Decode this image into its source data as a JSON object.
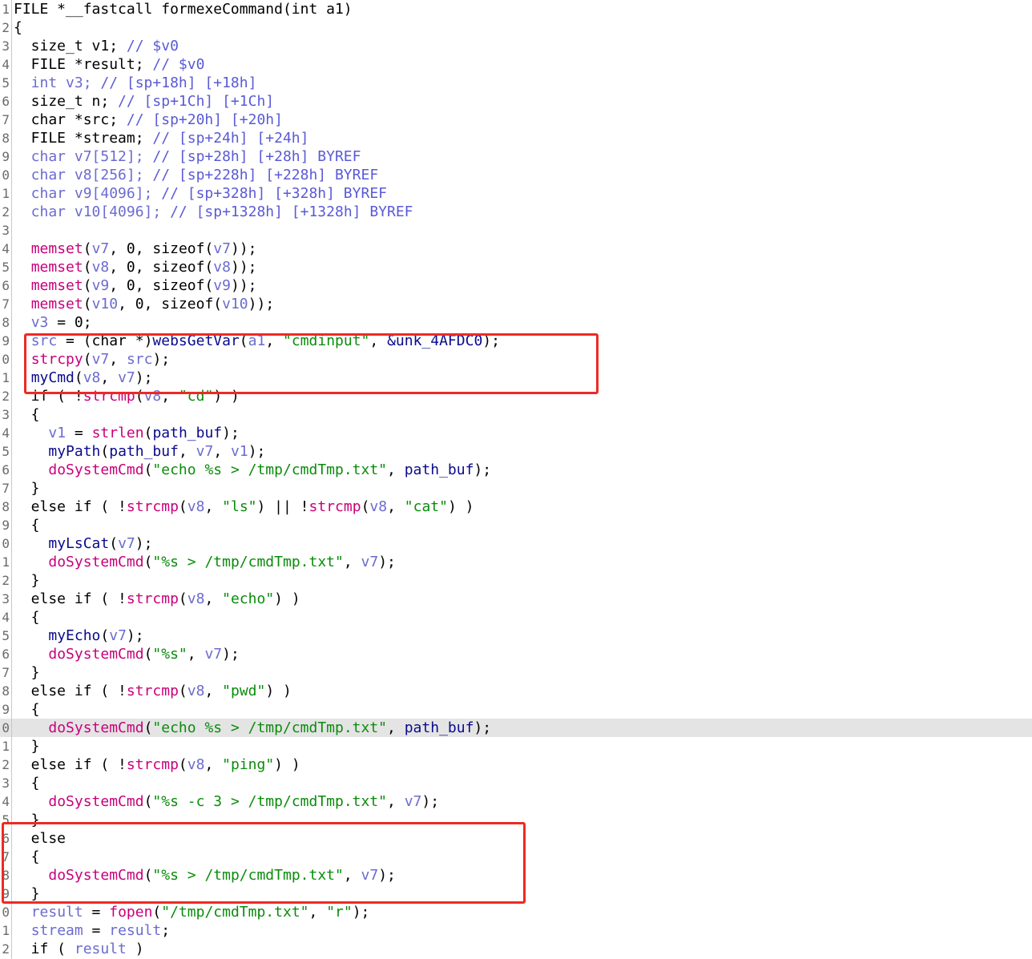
{
  "editor": {
    "view": "pseudocode",
    "highlight_color": "#e4e4e4",
    "annotation_color": "#ee2a24",
    "highlighted_line": 40,
    "colors": {
      "keyword": "#000000",
      "variable": "#6b6bd0",
      "comment": "#5a5ad6",
      "library_function": "#c8007a",
      "user_function": "#0a0a8c",
      "string": "#0a8c0a",
      "global": "#0a0a8c"
    },
    "lines": [
      {
        "n": "1",
        "t": [
          [
            "k",
            "FILE *__fastcall formexeCommand(int a1)"
          ]
        ]
      },
      {
        "n": "2",
        "t": [
          [
            "k",
            "{"
          ]
        ]
      },
      {
        "n": "3",
        "t": [
          [
            "k",
            "  size_t v1; "
          ],
          [
            "c",
            "// $v0"
          ]
        ]
      },
      {
        "n": "4",
        "t": [
          [
            "k",
            "  FILE *result; "
          ],
          [
            "c",
            "// $v0"
          ]
        ]
      },
      {
        "n": "5",
        "t": [
          [
            "v",
            "  int v3; "
          ],
          [
            "c",
            "// [sp+18h] [+18h]"
          ]
        ]
      },
      {
        "n": "6",
        "t": [
          [
            "k",
            "  size_t n; "
          ],
          [
            "c",
            "// [sp+1Ch] [+1Ch]"
          ]
        ]
      },
      {
        "n": "7",
        "t": [
          [
            "k",
            "  char *src; "
          ],
          [
            "c",
            "// [sp+20h] [+20h]"
          ]
        ]
      },
      {
        "n": "8",
        "t": [
          [
            "k",
            "  FILE *stream; "
          ],
          [
            "c",
            "// [sp+24h] [+24h]"
          ]
        ]
      },
      {
        "n": "9",
        "t": [
          [
            "v",
            "  char v7[512]; "
          ],
          [
            "c",
            "// [sp+28h] [+28h] BYREF"
          ]
        ]
      },
      {
        "n": "0",
        "t": [
          [
            "v",
            "  char v8[256]; "
          ],
          [
            "c",
            "// [sp+228h] [+228h] BYREF"
          ]
        ]
      },
      {
        "n": "1",
        "t": [
          [
            "v",
            "  char v9[4096]; "
          ],
          [
            "c",
            "// [sp+328h] [+328h] BYREF"
          ]
        ]
      },
      {
        "n": "2",
        "t": [
          [
            "v",
            "  char v10[4096]; "
          ],
          [
            "c",
            "// [sp+1328h] [+1328h] BYREF"
          ]
        ]
      },
      {
        "n": "3",
        "t": []
      },
      {
        "n": "4",
        "t": [
          [
            "k",
            "  "
          ],
          [
            "f",
            "memset"
          ],
          [
            "k",
            "("
          ],
          [
            "v",
            "v7"
          ],
          [
            "k",
            ", 0, sizeof("
          ],
          [
            "v",
            "v7"
          ],
          [
            "k",
            "));"
          ]
        ]
      },
      {
        "n": "5",
        "t": [
          [
            "k",
            "  "
          ],
          [
            "f",
            "memset"
          ],
          [
            "k",
            "("
          ],
          [
            "v",
            "v8"
          ],
          [
            "k",
            ", 0, sizeof("
          ],
          [
            "v",
            "v8"
          ],
          [
            "k",
            "));"
          ]
        ]
      },
      {
        "n": "6",
        "t": [
          [
            "k",
            "  "
          ],
          [
            "f",
            "memset"
          ],
          [
            "k",
            "("
          ],
          [
            "v",
            "v9"
          ],
          [
            "k",
            ", 0, sizeof("
          ],
          [
            "v",
            "v9"
          ],
          [
            "k",
            "));"
          ]
        ]
      },
      {
        "n": "7",
        "t": [
          [
            "k",
            "  "
          ],
          [
            "f",
            "memset"
          ],
          [
            "k",
            "("
          ],
          [
            "v",
            "v10"
          ],
          [
            "k",
            ", 0, sizeof("
          ],
          [
            "v",
            "v10"
          ],
          [
            "k",
            "));"
          ]
        ]
      },
      {
        "n": "8",
        "t": [
          [
            "k",
            "  "
          ],
          [
            "v",
            "v3"
          ],
          [
            "k",
            " = 0;"
          ]
        ]
      },
      {
        "n": "9",
        "t": [
          [
            "k",
            "  "
          ],
          [
            "v",
            "src"
          ],
          [
            "k",
            " = (char *)"
          ],
          [
            "u",
            "websGetVar"
          ],
          [
            "k",
            "("
          ],
          [
            "v",
            "a1"
          ],
          [
            "k",
            ", "
          ],
          [
            "s",
            "\"cmdinput\""
          ],
          [
            "k",
            ", "
          ],
          [
            "g",
            "&unk_4AFDC0"
          ],
          [
            "k",
            ");"
          ]
        ]
      },
      {
        "n": "0",
        "t": [
          [
            "k",
            "  "
          ],
          [
            "f",
            "strcpy"
          ],
          [
            "k",
            "("
          ],
          [
            "v",
            "v7"
          ],
          [
            "k",
            ", "
          ],
          [
            "v",
            "src"
          ],
          [
            "k",
            ");"
          ]
        ]
      },
      {
        "n": "1",
        "t": [
          [
            "k",
            "  "
          ],
          [
            "u",
            "myCmd"
          ],
          [
            "k",
            "("
          ],
          [
            "v",
            "v8"
          ],
          [
            "k",
            ", "
          ],
          [
            "v",
            "v7"
          ],
          [
            "k",
            ");"
          ]
        ]
      },
      {
        "n": "2",
        "t": [
          [
            "k",
            "  if ( !"
          ],
          [
            "f",
            "strcmp"
          ],
          [
            "k",
            "("
          ],
          [
            "v",
            "v8"
          ],
          [
            "k",
            ", "
          ],
          [
            "s",
            "\"cd\""
          ],
          [
            "k",
            ") )"
          ]
        ]
      },
      {
        "n": "3",
        "t": [
          [
            "k",
            "  {"
          ]
        ]
      },
      {
        "n": "4",
        "t": [
          [
            "k",
            "    "
          ],
          [
            "v",
            "v1"
          ],
          [
            "k",
            " = "
          ],
          [
            "f",
            "strlen"
          ],
          [
            "k",
            "("
          ],
          [
            "g",
            "path_buf"
          ],
          [
            "k",
            ");"
          ]
        ]
      },
      {
        "n": "5",
        "t": [
          [
            "k",
            "    "
          ],
          [
            "u",
            "myPath"
          ],
          [
            "k",
            "("
          ],
          [
            "g",
            "path_buf"
          ],
          [
            "k",
            ", "
          ],
          [
            "v",
            "v7"
          ],
          [
            "k",
            ", "
          ],
          [
            "v",
            "v1"
          ],
          [
            "k",
            ");"
          ]
        ]
      },
      {
        "n": "6",
        "t": [
          [
            "k",
            "    "
          ],
          [
            "f",
            "doSystemCmd"
          ],
          [
            "k",
            "("
          ],
          [
            "s",
            "\"echo %s > /tmp/cmdTmp.txt\""
          ],
          [
            "k",
            ", "
          ],
          [
            "g",
            "path_buf"
          ],
          [
            "k",
            ");"
          ]
        ]
      },
      {
        "n": "7",
        "t": [
          [
            "k",
            "  }"
          ]
        ]
      },
      {
        "n": "8",
        "t": [
          [
            "k",
            "  else if ( !"
          ],
          [
            "f",
            "strcmp"
          ],
          [
            "k",
            "("
          ],
          [
            "v",
            "v8"
          ],
          [
            "k",
            ", "
          ],
          [
            "s",
            "\"ls\""
          ],
          [
            "k",
            ") || !"
          ],
          [
            "f",
            "strcmp"
          ],
          [
            "k",
            "("
          ],
          [
            "v",
            "v8"
          ],
          [
            "k",
            ", "
          ],
          [
            "s",
            "\"cat\""
          ],
          [
            "k",
            ") )"
          ]
        ]
      },
      {
        "n": "9",
        "t": [
          [
            "k",
            "  {"
          ]
        ]
      },
      {
        "n": "0",
        "t": [
          [
            "k",
            "    "
          ],
          [
            "u",
            "myLsCat"
          ],
          [
            "k",
            "("
          ],
          [
            "v",
            "v7"
          ],
          [
            "k",
            ");"
          ]
        ]
      },
      {
        "n": "1",
        "t": [
          [
            "k",
            "    "
          ],
          [
            "f",
            "doSystemCmd"
          ],
          [
            "k",
            "("
          ],
          [
            "s",
            "\"%s > /tmp/cmdTmp.txt\""
          ],
          [
            "k",
            ", "
          ],
          [
            "v",
            "v7"
          ],
          [
            "k",
            ");"
          ]
        ]
      },
      {
        "n": "2",
        "t": [
          [
            "k",
            "  }"
          ]
        ]
      },
      {
        "n": "3",
        "t": [
          [
            "k",
            "  else if ( !"
          ],
          [
            "f",
            "strcmp"
          ],
          [
            "k",
            "("
          ],
          [
            "v",
            "v8"
          ],
          [
            "k",
            ", "
          ],
          [
            "s",
            "\"echo\""
          ],
          [
            "k",
            ") )"
          ]
        ]
      },
      {
        "n": "4",
        "t": [
          [
            "k",
            "  {"
          ]
        ]
      },
      {
        "n": "5",
        "t": [
          [
            "k",
            "    "
          ],
          [
            "u",
            "myEcho"
          ],
          [
            "k",
            "("
          ],
          [
            "v",
            "v7"
          ],
          [
            "k",
            ");"
          ]
        ]
      },
      {
        "n": "6",
        "t": [
          [
            "k",
            "    "
          ],
          [
            "f",
            "doSystemCmd"
          ],
          [
            "k",
            "("
          ],
          [
            "s",
            "\"%s\""
          ],
          [
            "k",
            ", "
          ],
          [
            "v",
            "v7"
          ],
          [
            "k",
            ");"
          ]
        ]
      },
      {
        "n": "7",
        "t": [
          [
            "k",
            "  }"
          ]
        ]
      },
      {
        "n": "8",
        "t": [
          [
            "k",
            "  else if ( !"
          ],
          [
            "f",
            "strcmp"
          ],
          [
            "k",
            "("
          ],
          [
            "v",
            "v8"
          ],
          [
            "k",
            ", "
          ],
          [
            "s",
            "\"pwd\""
          ],
          [
            "k",
            ") )"
          ]
        ]
      },
      {
        "n": "9",
        "t": [
          [
            "k",
            "  {"
          ]
        ]
      },
      {
        "n": "0",
        "t": [
          [
            "k",
            "    "
          ],
          [
            "f",
            "doSystemCmd"
          ],
          [
            "k",
            "("
          ],
          [
            "s",
            "\"echo %s > /tmp/cmdTmp.txt\""
          ],
          [
            "k",
            ", "
          ],
          [
            "g",
            "path_buf"
          ],
          [
            "k",
            ");"
          ]
        ]
      },
      {
        "n": "1",
        "t": [
          [
            "k",
            "  }"
          ]
        ]
      },
      {
        "n": "2",
        "t": [
          [
            "k",
            "  else if ( !"
          ],
          [
            "f",
            "strcmp"
          ],
          [
            "k",
            "("
          ],
          [
            "v",
            "v8"
          ],
          [
            "k",
            ", "
          ],
          [
            "s",
            "\"ping\""
          ],
          [
            "k",
            ") )"
          ]
        ]
      },
      {
        "n": "3",
        "t": [
          [
            "k",
            "  {"
          ]
        ]
      },
      {
        "n": "4",
        "t": [
          [
            "k",
            "    "
          ],
          [
            "f",
            "doSystemCmd"
          ],
          [
            "k",
            "("
          ],
          [
            "s",
            "\"%s -c 3 > /tmp/cmdTmp.txt\""
          ],
          [
            "k",
            ", "
          ],
          [
            "v",
            "v7"
          ],
          [
            "k",
            ");"
          ]
        ]
      },
      {
        "n": "5",
        "t": [
          [
            "k",
            "  }"
          ]
        ]
      },
      {
        "n": "6",
        "t": [
          [
            "k",
            "  else"
          ]
        ]
      },
      {
        "n": "7",
        "t": [
          [
            "k",
            "  {"
          ]
        ]
      },
      {
        "n": "8",
        "t": [
          [
            "k",
            "    "
          ],
          [
            "f",
            "doSystemCmd"
          ],
          [
            "k",
            "("
          ],
          [
            "s",
            "\"%s > /tmp/cmdTmp.txt\""
          ],
          [
            "k",
            ", "
          ],
          [
            "v",
            "v7"
          ],
          [
            "k",
            ");"
          ]
        ]
      },
      {
        "n": "9",
        "t": [
          [
            "k",
            "  }"
          ]
        ]
      },
      {
        "n": "0",
        "t": [
          [
            "k",
            "  "
          ],
          [
            "v",
            "result"
          ],
          [
            "k",
            " = "
          ],
          [
            "f",
            "fopen"
          ],
          [
            "k",
            "("
          ],
          [
            "s",
            "\"/tmp/cmdTmp.txt\""
          ],
          [
            "k",
            ", "
          ],
          [
            "s",
            "\"r\""
          ],
          [
            "k",
            ");"
          ]
        ]
      },
      {
        "n": "1",
        "t": [
          [
            "k",
            "  "
          ],
          [
            "v",
            "stream"
          ],
          [
            "k",
            " = "
          ],
          [
            "v",
            "result"
          ],
          [
            "k",
            ";"
          ]
        ]
      },
      {
        "n": "2",
        "t": [
          [
            "k",
            "  if ( "
          ],
          [
            "v",
            "result"
          ],
          [
            "k",
            " )"
          ]
        ]
      }
    ]
  }
}
